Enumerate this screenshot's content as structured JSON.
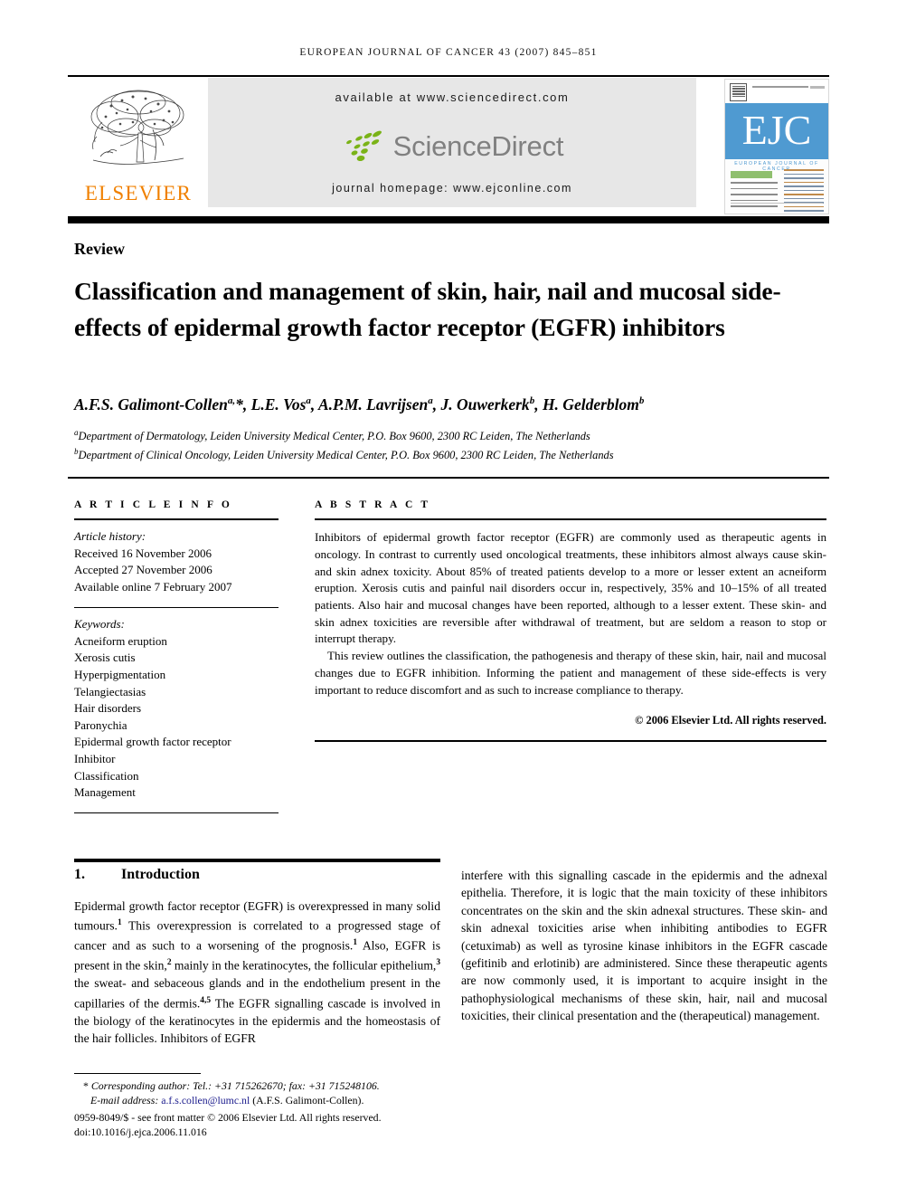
{
  "running_head": "EUROPEAN JOURNAL OF CANCER 43 (2007) 845–851",
  "masthead": {
    "available_at": "available at www.sciencedirect.com",
    "sciencedirect_logo_text": "ScienceDirect",
    "journal_homepage": "journal homepage: www.ejconline.com",
    "elsevier_logo_text": "ELSEVIER",
    "cover": {
      "letters": "EJC",
      "subtitle": "EUROPEAN JOURNAL OF CANCER"
    },
    "colors": {
      "banner_bg": "#e7e7e7",
      "leaf_green": "#7ab317",
      "sciencedirect_gray": "#808080",
      "elsevier_orange": "#f08000",
      "cover_blue": "#4f9ad1",
      "cover_green": "#8fbf6e"
    }
  },
  "article": {
    "doctype": "Review",
    "title": "Classification and management of skin, hair, nail and mucosal side-effects of epidermal growth factor receptor (EGFR) inhibitors",
    "authors_html": "A.F.S. Galimont-Collen<sup>a,</sup>*, L.E. Vos<sup>a</sup>, A.P.M. Lavrijsen<sup>a</sup>, J. Ouwerkerk<sup>b</sup>, H. Gelderblom<sup>b</sup>",
    "affiliations": [
      "Department of Dermatology, Leiden University Medical Center, P.O. Box 9600, 2300 RC Leiden, The Netherlands",
      "Department of Clinical Oncology, Leiden University Medical Center, P.O. Box 9600, 2300 RC Leiden, The Netherlands"
    ],
    "affiliation_markers": [
      "a",
      "b"
    ]
  },
  "article_info": {
    "heading": "A R T I C L E   I N F O",
    "history_label": "Article history:",
    "history": [
      "Received 16 November 2006",
      "Accepted 27 November 2006",
      "Available online 7 February 2007"
    ],
    "keywords_label": "Keywords:",
    "keywords": [
      "Acneiform eruption",
      "Xerosis cutis",
      "Hyperpigmentation",
      "Telangiectasias",
      "Hair disorders",
      "Paronychia",
      "Epidermal growth factor receptor",
      "Inhibitor",
      "Classification",
      "Management"
    ]
  },
  "abstract": {
    "heading": "A B S T R A C T",
    "paragraphs": [
      "Inhibitors of epidermal growth factor receptor (EGFR) are commonly used as therapeutic agents in oncology. In contrast to currently used oncological treatments, these inhibitors almost always cause skin- and skin adnex toxicity. About 85% of treated patients develop to a more or lesser extent an acneiform eruption. Xerosis cutis and painful nail disorders occur in, respectively, 35% and 10–15% of all treated patients. Also hair and mucosal changes have been reported, although to a lesser extent. These skin- and skin adnex toxicities are reversible after withdrawal of treatment, but are seldom a reason to stop or interrupt therapy.",
      "This review outlines the classification, the pathogenesis and therapy of these skin, hair, nail and mucosal changes due to EGFR inhibition. Informing the patient and management of these side-effects is very important to reduce discomfort and as such to increase compliance to therapy."
    ],
    "copyright": "© 2006 Elsevier Ltd. All rights reserved."
  },
  "body": {
    "section_number": "1.",
    "section_title": "Introduction",
    "left_column_html": "Epidermal growth factor receptor (EGFR) is overexpressed in many solid tumours.<sup>1</sup> This overexpression is correlated to a progressed stage of cancer and as such to a worsening of the prognosis.<sup>1</sup> Also, EGFR is present in the skin,<sup>2</sup> mainly in the keratinocytes, the follicular epithelium,<sup>3</sup> the sweat- and sebaceous glands and in the endothelium present in the capillaries of the dermis.<sup>4,5</sup> The EGFR signalling cascade is involved in the biology of the keratinocytes in the epidermis and the homeostasis of the hair follicles. Inhibitors of EGFR",
    "right_column_html": "interfere with this signalling cascade in the epidermis and the adnexal epithelia. Therefore, it is logic that the main toxicity of these inhibitors concentrates on the skin and the skin adnexal structures. These skin- and skin adnexal toxicities arise when inhibiting antibodies to EGFR (cetuximab) as well as tyrosine kinase inhibitors in the EGFR cascade (gefitinib and erlotinib) are administered. Since these therapeutic agents are now commonly used, it is important to acquire insight in the pathophysiological mechanisms of these skin, hair, nail and mucosal toxicities, their clinical presentation and the (therapeutical) management."
  },
  "footnote": {
    "corresponding_label": "Corresponding author:",
    "corresponding_rest": " Tel.: +31 715262670; fax: +31 715248106.",
    "email_label": "E-mail address:",
    "email": "a.f.s.collen@lumc.nl",
    "email_owner": "(A.F.S. Galimont-Collen).",
    "issn_line": "0959-8049/$ - see front matter © 2006 Elsevier Ltd. All rights reserved.",
    "doi_line": "doi:10.1016/j.ejca.2006.11.016"
  }
}
